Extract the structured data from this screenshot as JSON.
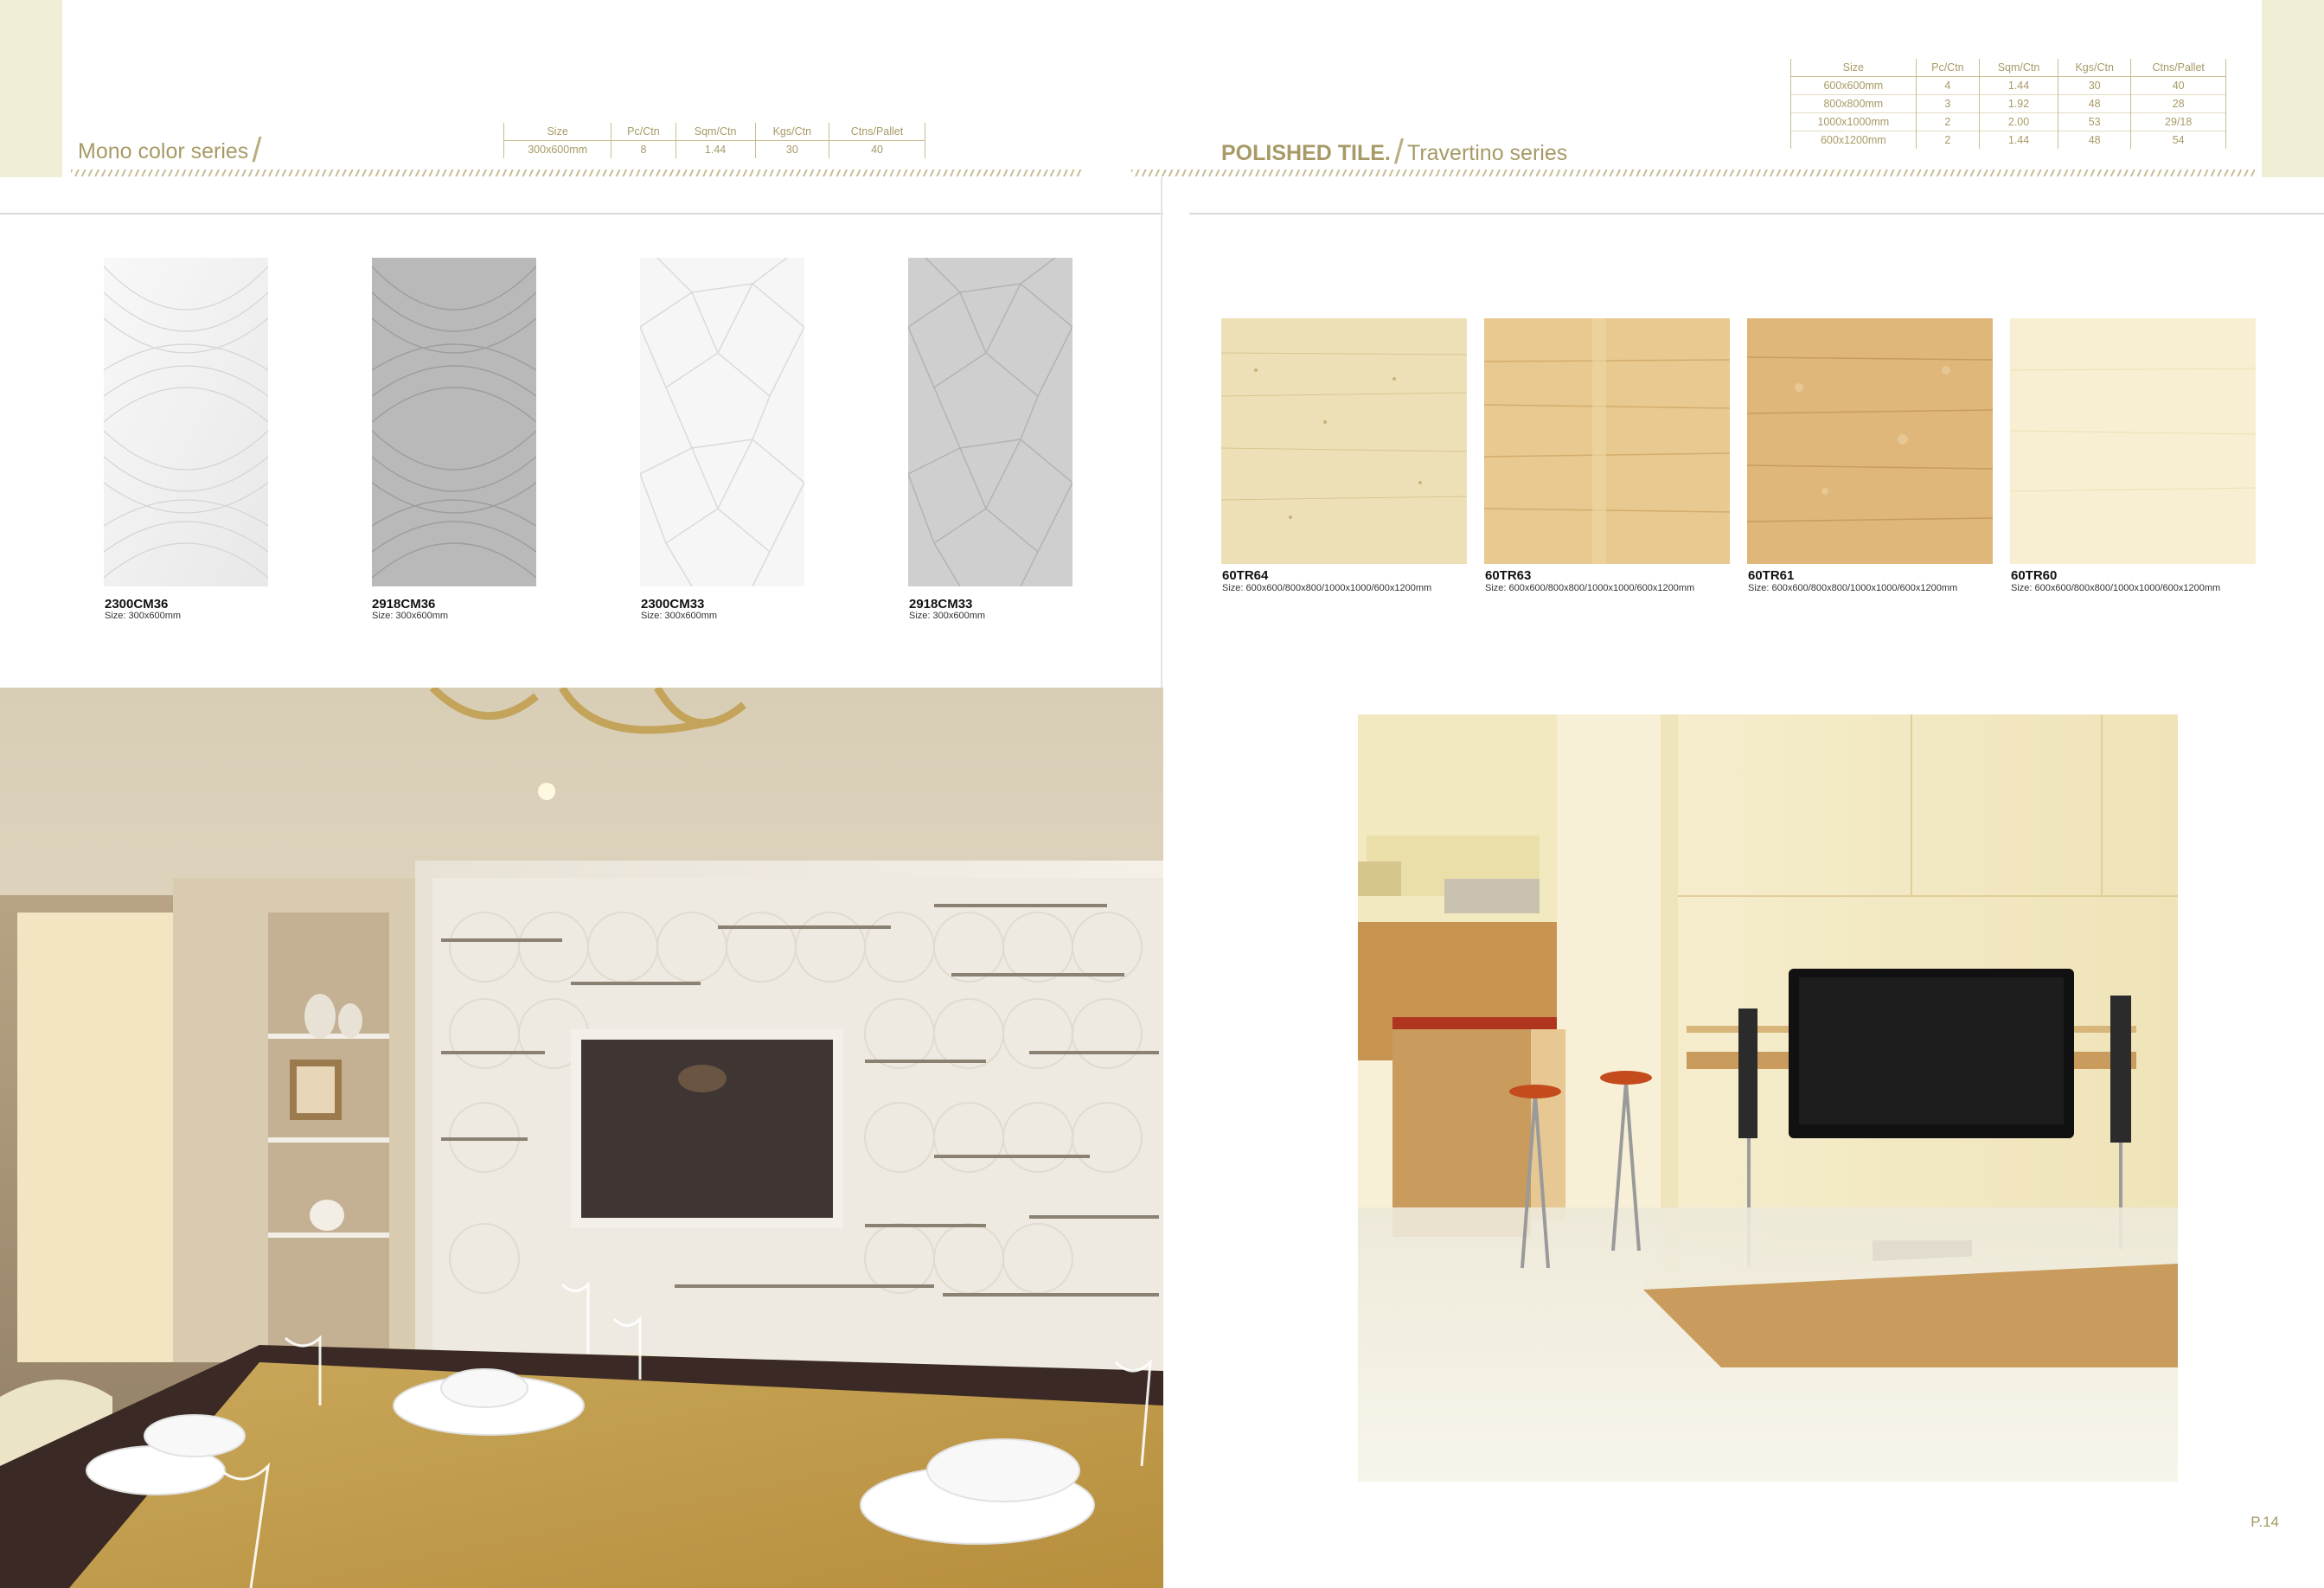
{
  "mono": {
    "title": "Mono color series",
    "table": {
      "headers": [
        "Size",
        "Pc/Ctn",
        "Sqm/Ctn",
        "Kgs/Ctn",
        "Ctns/Pallet"
      ],
      "rows": [
        [
          "300x600mm",
          "8",
          "1.44",
          "30",
          "40"
        ]
      ]
    },
    "tiles": [
      {
        "code": "2300CM36",
        "size": "Size: 300x600mm"
      },
      {
        "code": "2918CM36",
        "size": "Size: 300x600mm"
      },
      {
        "code": "2300CM33",
        "size": "Size: 300x600mm"
      },
      {
        "code": "2918CM33",
        "size": "Size: 300x600mm"
      }
    ]
  },
  "polished": {
    "brand": "POLISHED TILE.",
    "title": "Travertino series",
    "table": {
      "headers": [
        "Size",
        "Pc/Ctn",
        "Sqm/Ctn",
        "Kgs/Ctn",
        "Ctns/Pallet"
      ],
      "rows": [
        [
          "600x600mm",
          "4",
          "1.44",
          "30",
          "40"
        ],
        [
          "800x800mm",
          "3",
          "1.92",
          "48",
          "28"
        ],
        [
          "1000x1000mm",
          "2",
          "2.00",
          "53",
          "29/18"
        ],
        [
          "600x1200mm",
          "2",
          "1.44",
          "48",
          "54"
        ]
      ]
    },
    "tiles": [
      {
        "code": "60TR64",
        "size": "Size: 600x600/800x800/1000x1000/600x1200mm"
      },
      {
        "code": "60TR63",
        "size": "Size: 600x600/800x800/1000x1000/600x1200mm"
      },
      {
        "code": "60TR61",
        "size": "Size: 600x600/800x800/1000x1000/600x1200mm"
      },
      {
        "code": "60TR60",
        "size": "Size: 600x600/800x800/1000x1000/600x1200mm"
      }
    ]
  },
  "page_number": "P.14"
}
